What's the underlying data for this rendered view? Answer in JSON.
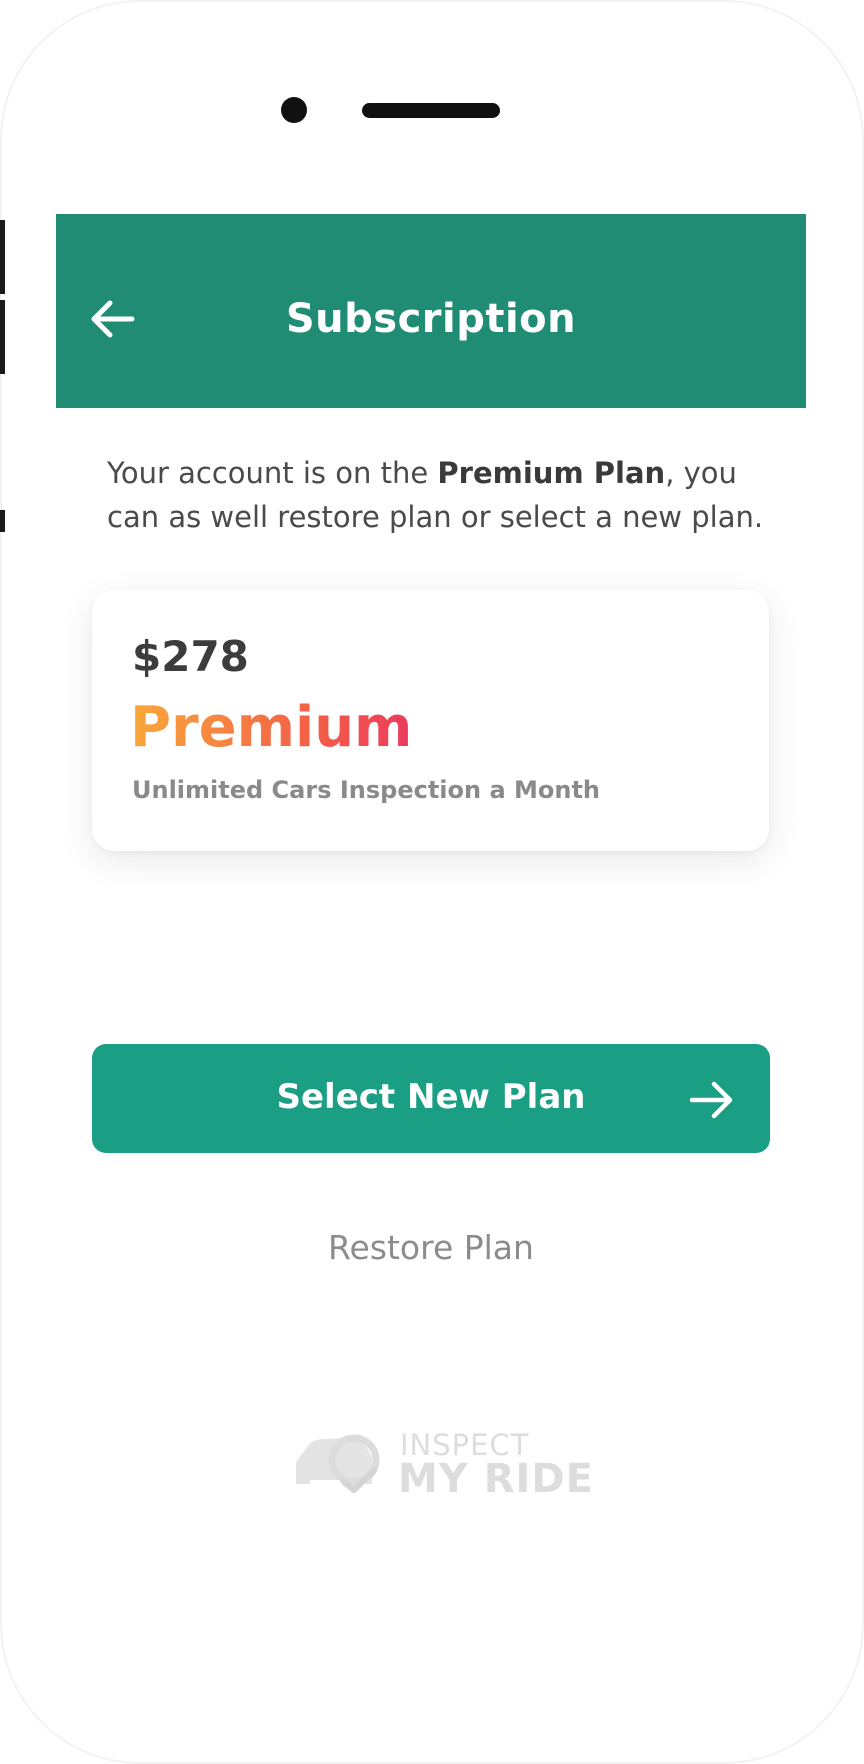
{
  "header": {
    "title": "Subscription",
    "back_icon": "arrow-left-icon",
    "background_color": "#218c74"
  },
  "info": {
    "prefix": "Your account is on the ",
    "plan_name": "Premium Plan",
    "suffix": ", you can as well restore plan or select a new plan."
  },
  "plan_card": {
    "price": "$278",
    "name": "Premium",
    "description": "Unlimited Cars Inspection a Month",
    "gradient_colors": [
      "#f9a83a",
      "#f3594a",
      "#ec3a5e"
    ]
  },
  "actions": {
    "select_label": "Select New Plan",
    "select_icon": "arrow-right-icon",
    "select_color": "#1a9e84",
    "restore_label": "Restore Plan"
  },
  "branding": {
    "line1": "INSPECT",
    "line2": "MY RIDE",
    "logo_icon": "car-check-logo"
  }
}
